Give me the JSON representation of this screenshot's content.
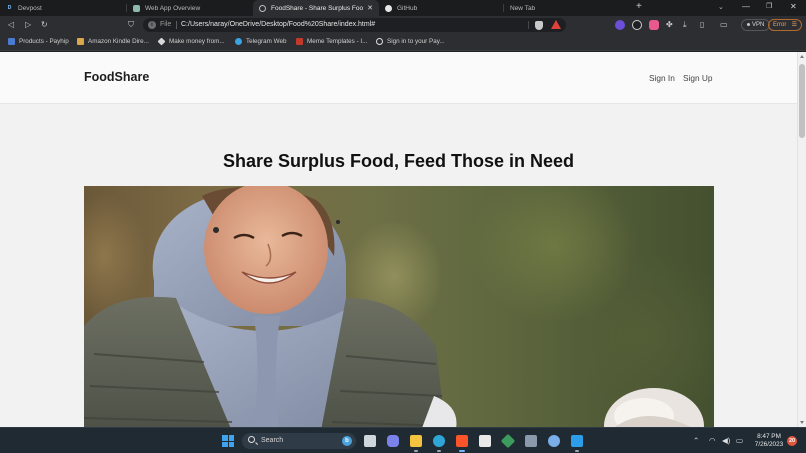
{
  "browser": {
    "tabs": [
      {
        "title": "Devpost",
        "favicon": "devpost-icon",
        "active": false,
        "closable": false
      },
      {
        "title": "Web App Overview",
        "favicon": "web-app-icon",
        "active": false,
        "closable": false
      },
      {
        "title": "FoodShare - Share Surplus Food, Feed...",
        "favicon": "globe-icon",
        "active": true,
        "closable": true
      },
      {
        "title": "GitHub",
        "favicon": "github-icon",
        "active": false,
        "closable": false
      },
      {
        "title": "New Tab",
        "favicon": "",
        "active": false,
        "closable": false
      }
    ],
    "new_tab": "+",
    "address": {
      "scheme": "File",
      "url": "C:/Users/naray/OneDrive/Desktop/Food%20Share/index.html#"
    },
    "vpn_label": "VPN",
    "error_label": "Error",
    "bookmarks": [
      {
        "label": "Products - Payhip",
        "icon": "payhip-icon",
        "color": "#4a7bd0"
      },
      {
        "label": "Amazon Kindle Dire...",
        "icon": "kindle-icon",
        "color": "#d8a84a"
      },
      {
        "label": "Make money from...",
        "icon": "diamond-icon",
        "color": "#d9d9d9"
      },
      {
        "label": "Telegram Web",
        "icon": "telegram-icon",
        "color": "#3aa3e0"
      },
      {
        "label": "Meme Templates - I...",
        "icon": "meme-icon",
        "color": "#c0392b"
      },
      {
        "label": "Sign in to your Pay...",
        "icon": "paypal-icon",
        "color": "#e0e0e0"
      }
    ]
  },
  "site": {
    "brand": "FoodShare",
    "nav": {
      "sign_in": "Sign In",
      "sign_up": "Sign Up"
    },
    "hero_title": "Share Surplus Food, Feed Those in Need"
  },
  "taskbar": {
    "search_placeholder": "Search",
    "apps": [
      {
        "name": "task-view-icon",
        "color": "#cfd6dc"
      },
      {
        "name": "teams-chat-icon",
        "color": "#7b83eb"
      },
      {
        "name": "file-explorer-icon",
        "color": "#f3c23e"
      },
      {
        "name": "edge-icon",
        "color": "#2fa6d8"
      },
      {
        "name": "brave-icon",
        "color": "#fb542b"
      },
      {
        "name": "store-icon",
        "color": "#e9e9e9"
      },
      {
        "name": "photos-icon",
        "color": "#3d9b5e"
      },
      {
        "name": "screenshot-icon",
        "color": "#8a9aaa"
      },
      {
        "name": "chrome-app-icon",
        "color": "#7aaee8"
      },
      {
        "name": "vscode-icon",
        "color": "#2b9de9"
      }
    ],
    "clock": {
      "time": "8:47 PM",
      "date": "7/26/2023"
    },
    "notifications": "20"
  }
}
